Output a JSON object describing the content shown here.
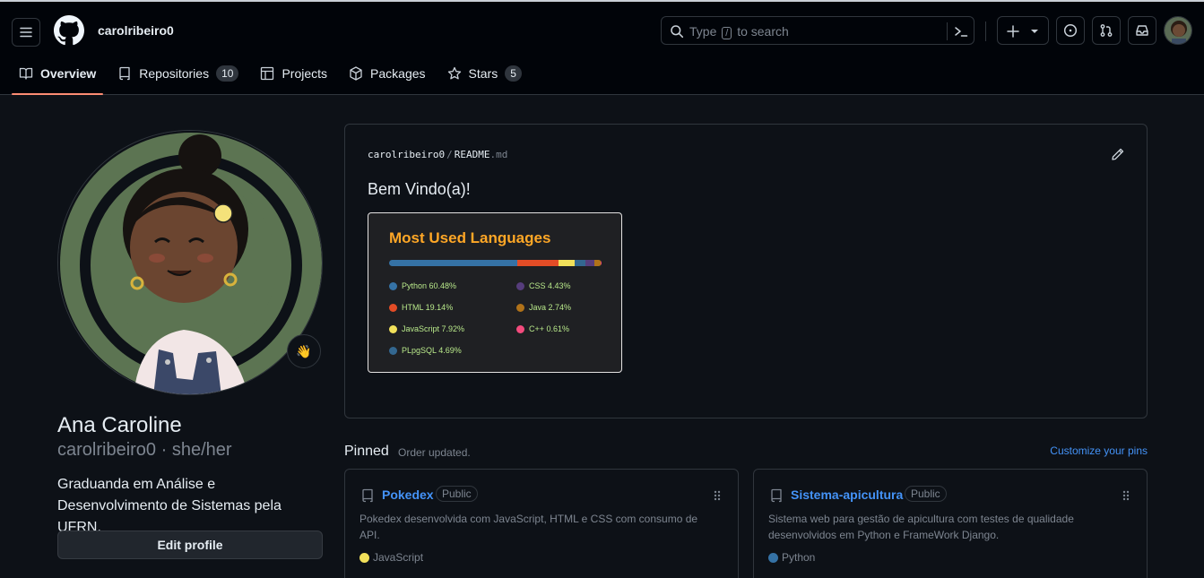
{
  "header": {
    "username": "carolribeiro0",
    "search": {
      "prefix": "Type",
      "key": "/",
      "suffix": "to search"
    },
    "tabs": [
      {
        "label": "Overview",
        "icon": "book-icon"
      },
      {
        "label": "Repositories",
        "count": "10",
        "icon": "repo-icon"
      },
      {
        "label": "Projects",
        "icon": "table-icon"
      },
      {
        "label": "Packages",
        "icon": "package-icon"
      },
      {
        "label": "Stars",
        "count": "5",
        "icon": "star-icon"
      }
    ]
  },
  "profile": {
    "fullname": "Ana Caroline",
    "login_line": "carolribeiro0 · she/her",
    "bio": "Graduanda em Análise e Desenvolvimento de Sistemas pela UFRN.",
    "edit_label": "Edit profile",
    "status_icon": "waving-hand-icon"
  },
  "readme": {
    "owner": "carolribeiro0",
    "separator": "/",
    "file": "README",
    "ext": ".md",
    "heading": "Bem Vindo(a)!",
    "card_title": "Most Used Languages",
    "languages": [
      {
        "label": "Python 60.48%",
        "name": "Python",
        "percent": 60.48,
        "color": "#3572A5"
      },
      {
        "label": "HTML 19.14%",
        "name": "HTML",
        "percent": 19.14,
        "color": "#e34c26"
      },
      {
        "label": "JavaScript 7.92%",
        "name": "JavaScript",
        "percent": 7.92,
        "color": "#f1e05a"
      },
      {
        "label": "PLpgSQL 4.69%",
        "name": "PLpgSQL",
        "percent": 4.69,
        "color": "#336790"
      },
      {
        "label": "CSS 4.43%",
        "name": "CSS",
        "percent": 4.43,
        "color": "#563d7c"
      },
      {
        "label": "Java 2.74%",
        "name": "Java",
        "percent": 2.74,
        "color": "#b07219"
      },
      {
        "label": "C++ 0.61%",
        "name": "C++",
        "percent": 0.61,
        "color": "#f34b7d"
      }
    ]
  },
  "pinned": {
    "title": "Pinned",
    "subtitle": "Order updated.",
    "customize": "Customize your pins",
    "repos": [
      {
        "name": "Pokedex",
        "badge": "Public",
        "description": "Pokedex desenvolvida com JavaScript, HTML e CSS com consumo de API.",
        "language": "JavaScript",
        "language_color": "#f1e05a"
      },
      {
        "name": "Sistema-apicultura",
        "badge": "Public",
        "description": "Sistema web para gestão de apicultura com testes de qualidade desenvolvidos em Python e FrameWork Django.",
        "language": "Python",
        "language_color": "#3572A5"
      }
    ]
  }
}
